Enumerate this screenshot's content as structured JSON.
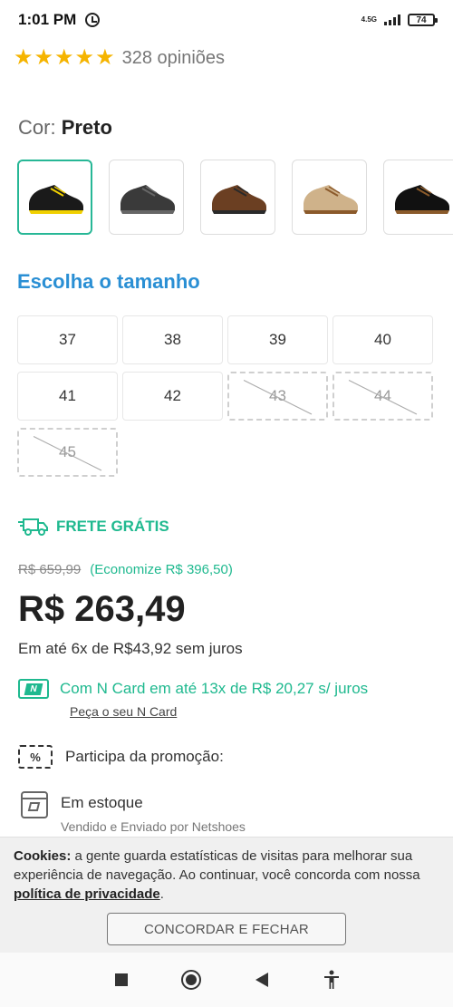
{
  "status_bar": {
    "time": "1:01 PM",
    "network": "4.5G",
    "battery": "74"
  },
  "rating": {
    "stars": 5,
    "count_text": "328 opiniões",
    "star_color": "#f5b400"
  },
  "color": {
    "label": "Cor:",
    "value": "Preto",
    "swatches": [
      {
        "name": "Preto",
        "shoe_color": "#1a1a1a",
        "accent": "#f0d000",
        "selected": true
      },
      {
        "name": "Grafite",
        "shoe_color": "#3a3a3a",
        "accent": "#666666",
        "selected": false
      },
      {
        "name": "Marrom",
        "shoe_color": "#6b3f22",
        "accent": "#2a2a2a",
        "selected": false
      },
      {
        "name": "Areia",
        "shoe_color": "#cfb28a",
        "accent": "#8b5a2b",
        "selected": false
      },
      {
        "name": "Preto/Marrom",
        "shoe_color": "#111111",
        "accent": "#8a5a2a",
        "selected": false
      }
    ]
  },
  "size": {
    "title": "Escolha o tamanho",
    "options": [
      {
        "label": "37",
        "available": true
      },
      {
        "label": "38",
        "available": true
      },
      {
        "label": "39",
        "available": true
      },
      {
        "label": "40",
        "available": true
      },
      {
        "label": "41",
        "available": true
      },
      {
        "label": "42",
        "available": true
      },
      {
        "label": "43",
        "available": false
      },
      {
        "label": "44",
        "available": false
      },
      {
        "label": "45",
        "available": false
      }
    ]
  },
  "shipping": {
    "free_label": "FRETE GRÁTIS"
  },
  "price": {
    "old": "R$ 659,99",
    "save": "(Economize R$ 396,50)",
    "current": "R$ 263,49",
    "installments": "Em até 6x de R$43,92 sem juros"
  },
  "ncard": {
    "icon_letter": "N",
    "text": "Com N Card em até 13x de R$ 20,27 s/ juros",
    "link": "Peça o seu N Card"
  },
  "promo": {
    "icon_text": "%",
    "text": "Participa da promoção:"
  },
  "stock": {
    "title": "Em estoque",
    "subtitle": "Vendido e Enviado por Netshoes"
  },
  "cookie": {
    "bold": "Cookies:",
    "text": " a gente guarda estatísticas de visitas para melhorar sua experiência de navegação. Ao continuar, você concorda com nossa ",
    "link": "política de privacidade",
    "end": ".",
    "button": "CONCORDAR E FECHAR"
  },
  "colors": {
    "accent_green": "#1fb98f",
    "title_blue": "#2a8fd4",
    "selected_border": "#27b796"
  }
}
